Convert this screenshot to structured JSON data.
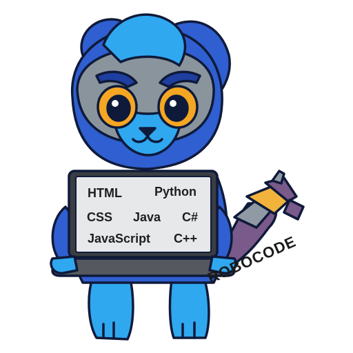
{
  "sticker": {
    "character": "blue-cat-robot",
    "laptop_screen": {
      "row1": [
        "HTML",
        "Python"
      ],
      "row2": [
        "CSS",
        "Java",
        "C#"
      ],
      "row3": [
        "JavaScript",
        "C++"
      ]
    },
    "brand": "ROBOCODE"
  },
  "colors": {
    "body_blue": "#2f5fd0",
    "light_blue": "#2fa8f0",
    "gray_mask": "#8a949c",
    "eye_yellow": "#f5a623",
    "laptop_dark": "#3a3d42",
    "screen_bg": "#e6e8ea",
    "tail_purple": "#7a5a8a",
    "tail_yellow": "#f2b33d"
  }
}
